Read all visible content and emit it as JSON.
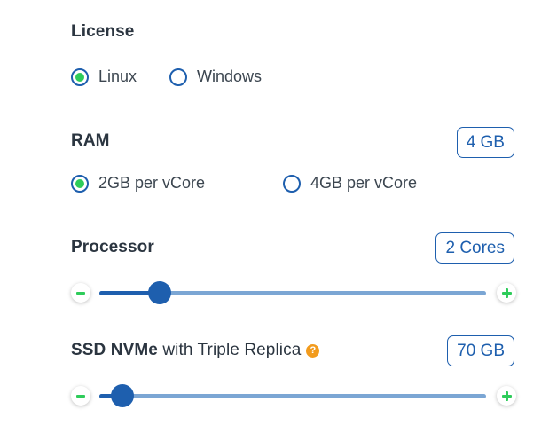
{
  "license": {
    "title": "License",
    "options": [
      {
        "label": "Linux",
        "selected": true
      },
      {
        "label": "Windows",
        "selected": false
      }
    ]
  },
  "ram": {
    "title": "RAM",
    "value": "4 GB",
    "options": [
      {
        "label": "2GB per vCore",
        "selected": true
      },
      {
        "label": "4GB per vCore",
        "selected": false
      }
    ]
  },
  "processor": {
    "title": "Processor",
    "value": "2 Cores",
    "slider_fraction": 0.155
  },
  "ssd": {
    "title_bold": "SSD NVMe",
    "title_rest": " with Triple Replica",
    "help_glyph": "?",
    "value": "70 GB",
    "slider_fraction": 0.06
  },
  "colors": {
    "accent": "#1e5fae",
    "selected": "#2ecc5a",
    "help": "#f29b1d"
  }
}
